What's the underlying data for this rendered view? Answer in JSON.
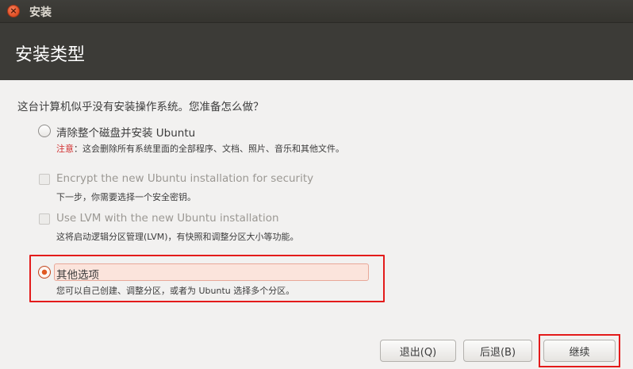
{
  "window": {
    "title": "安装",
    "close_glyph": "×"
  },
  "header": {
    "title": "安装类型"
  },
  "question": "这台计算机似乎没有安装操作系统。您准备怎么做？",
  "options": {
    "erase": {
      "label": "清除整个磁盘并安装 Ubuntu",
      "warning_label": "注意",
      "warning_text": "：这会删除所有系统里面的全部程序、文档、照片、音乐和其他文件。",
      "selected": false
    },
    "encrypt": {
      "label": "Encrypt the new Ubuntu installation for security",
      "description": "下一步，你需要选择一个安全密钥。",
      "checked": false,
      "enabled": false
    },
    "lvm": {
      "label": "Use LVM with the new Ubuntu installation",
      "description": "这将启动逻辑分区管理(LVM)，有快照和调整分区大小等功能。",
      "checked": false,
      "enabled": false
    },
    "other": {
      "label": "其他选项",
      "description": "您可以自己创建、调整分区，或者为 Ubuntu 选择多个分区。",
      "selected": true
    }
  },
  "buttons": {
    "quit": "退出(Q)",
    "back": "后退(B)",
    "continue": "继续"
  },
  "colors": {
    "accent": "#e05a24",
    "highlight_red": "#e31b1b",
    "header_bg": "#3c3b37"
  }
}
